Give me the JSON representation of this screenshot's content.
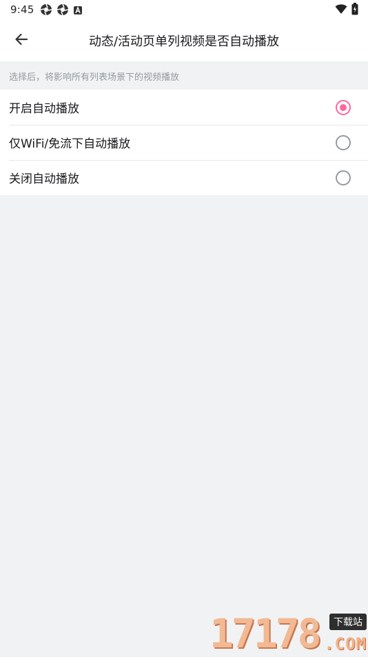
{
  "status_bar": {
    "time": "9:45",
    "left_icons": [
      "aperture-icon",
      "aperture-icon",
      "a-notification-icon"
    ],
    "right_icons": [
      "wifi-icon",
      "battery-icon"
    ]
  },
  "header": {
    "title": "动态/活动页单列视频是否自动播放",
    "back_icon": "arrow-left-icon"
  },
  "hint": "选择后，将影响所有列表场景下的视频播放",
  "options": [
    {
      "label": "开启自动播放",
      "selected": true
    },
    {
      "label": "仅WiFi/免流下自动播放",
      "selected": false
    },
    {
      "label": "关闭自动播放",
      "selected": false
    }
  ],
  "colors": {
    "accent": "#ff6699",
    "background": "#f1f2f3",
    "text_primary": "#18191c",
    "text_secondary": "#9499a0"
  },
  "watermark": {
    "digits": "17178",
    "badge": "下载站",
    "suffix": ".COM"
  }
}
